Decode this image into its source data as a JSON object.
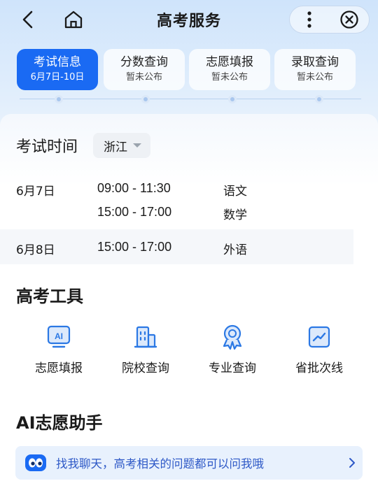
{
  "header": {
    "title": "高考服务"
  },
  "steps": [
    {
      "label": "考试信息",
      "sub": "6月7日-10日",
      "active": true
    },
    {
      "label": "分数查询",
      "sub": "暂未公布",
      "active": false
    },
    {
      "label": "志愿填报",
      "sub": "暂未公布",
      "active": false
    },
    {
      "label": "录取查询",
      "sub": "暂未公布",
      "active": false
    }
  ],
  "exam": {
    "title": "考试时间",
    "province": "浙江",
    "rows": [
      {
        "date": "6月7日",
        "time": "09:00 - 11:30",
        "subject": "语文"
      },
      {
        "date": "",
        "time": "15:00 - 17:00",
        "subject": "数学"
      },
      {
        "date": "6月8日",
        "time": "15:00 - 17:00",
        "subject": "外语"
      }
    ]
  },
  "tools": {
    "title": "高考工具",
    "items": [
      {
        "label": "志愿填报",
        "icon": "ai-board-icon"
      },
      {
        "label": "院校查询",
        "icon": "building-icon"
      },
      {
        "label": "专业查询",
        "icon": "medal-icon"
      },
      {
        "label": "省批次线",
        "icon": "trend-chart-icon"
      }
    ]
  },
  "assistant": {
    "title": "AI志愿助手",
    "prompt": "找我聊天，高考相关的问题都可以问我哦"
  },
  "colors": {
    "accent": "#1a6af3",
    "icon": "#2b78e4",
    "assistant_text": "#2e59c7"
  }
}
